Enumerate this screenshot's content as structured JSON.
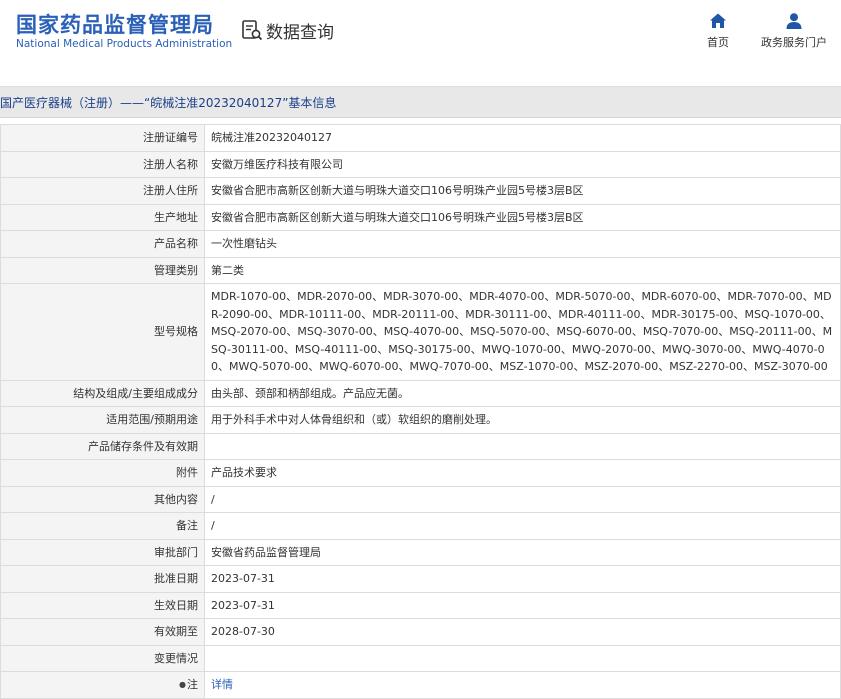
{
  "header": {
    "logo_cn": "国家药品监督管理局",
    "logo_en": "National Medical Products Administration",
    "query_title": "数据查询",
    "nav_home": "首页",
    "nav_portal": "政务服务门户"
  },
  "breadcrumb": "国产医疗器械（注册）——“皖械注准20232040127”基本信息",
  "rows": [
    {
      "label": "注册证编号",
      "value": "皖械注准20232040127"
    },
    {
      "label": "注册人名称",
      "value": "安徽万维医疗科技有限公司"
    },
    {
      "label": "注册人住所",
      "value": "安徽省合肥市高新区创新大道与明珠大道交口106号明珠产业园5号楼3层B区"
    },
    {
      "label": "生产地址",
      "value": "安徽省合肥市高新区创新大道与明珠大道交口106号明珠产业园5号楼3层B区"
    },
    {
      "label": "产品名称",
      "value": "一次性磨钻头"
    },
    {
      "label": "管理类别",
      "value": "第二类"
    },
    {
      "label": "型号规格",
      "value": "MDR-1070-00、MDR-2070-00、MDR-3070-00、MDR-4070-00、MDR-5070-00、MDR-6070-00、MDR-7070-00、MDR-2090-00、MDR-10111-00、MDR-20111-00、MDR-30111-00、MDR-40111-00、MDR-30175-00、MSQ-1070-00、MSQ-2070-00、MSQ-3070-00、MSQ-4070-00、MSQ-5070-00、MSQ-6070-00、MSQ-7070-00、MSQ-20111-00、MSQ-30111-00、MSQ-40111-00、MSQ-30175-00、MWQ-1070-00、MWQ-2070-00、MWQ-3070-00、MWQ-4070-00、MWQ-5070-00、MWQ-6070-00、MWQ-7070-00、MSZ-1070-00、MSZ-2070-00、MSZ-2270-00、MSZ-3070-00"
    },
    {
      "label": "结构及组成/主要组成成分",
      "value": "由头部、颈部和柄部组成。产品应无菌。"
    },
    {
      "label": "适用范围/预期用途",
      "value": "用于外科手术中对人体骨组织和（或）软组织的磨削处理。"
    },
    {
      "label": "产品储存条件及有效期",
      "value": ""
    },
    {
      "label": "附件",
      "value": "产品技术要求"
    },
    {
      "label": "其他内容",
      "value": "/"
    },
    {
      "label": "备注",
      "value": "/"
    },
    {
      "label": "审批部门",
      "value": "安徽省药品监督管理局"
    },
    {
      "label": "批准日期",
      "value": "2023-07-31"
    },
    {
      "label": "生效日期",
      "value": "2023-07-31"
    },
    {
      "label": "有效期至",
      "value": "2028-07-30"
    },
    {
      "label": "变更情况",
      "value": ""
    }
  ],
  "note_row": {
    "label": "注",
    "link": "详情"
  }
}
